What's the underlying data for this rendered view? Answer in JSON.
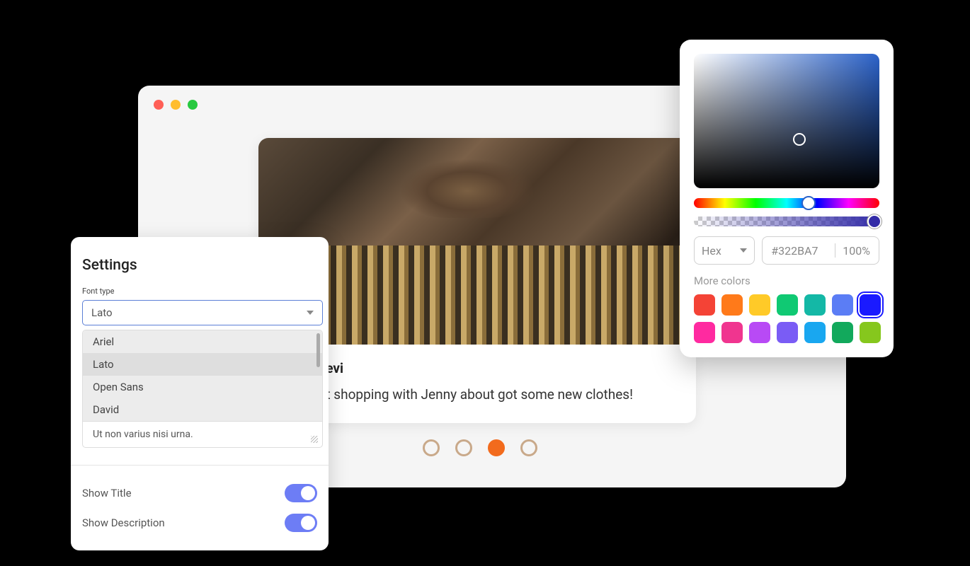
{
  "browser": {
    "card": {
      "username": "Stacie.Levi",
      "caption": "Went out shopping with Jenny about got some new clothes!"
    },
    "pagination": {
      "count": 4,
      "active_index": 2
    }
  },
  "settings": {
    "title": "Settings",
    "font_label": "Font type",
    "selected_font": "Lato",
    "font_options": [
      "Ariel",
      "Lato",
      "Open Sans",
      "David"
    ],
    "textarea_value": "Ut non varius nisi urna.",
    "toggles": [
      {
        "label": "Show Title",
        "value": true
      },
      {
        "label": "Show Description",
        "value": true
      }
    ]
  },
  "picker": {
    "format": "Hex",
    "hex": "#322BA7",
    "alpha": "100%",
    "more_label": "More colors",
    "swatches_row1": [
      "#f44336",
      "#ff7a1a",
      "#ffca28",
      "#10c973",
      "#14b8a6",
      "#5b7df5",
      "#1a1aff"
    ],
    "swatches_row2": [
      "#ff2aa0",
      "#f0358f",
      "#b84af5",
      "#7a5cf5",
      "#19a7f0",
      "#12a95c",
      "#86c71d"
    ],
    "selected_swatch_index": 6
  }
}
